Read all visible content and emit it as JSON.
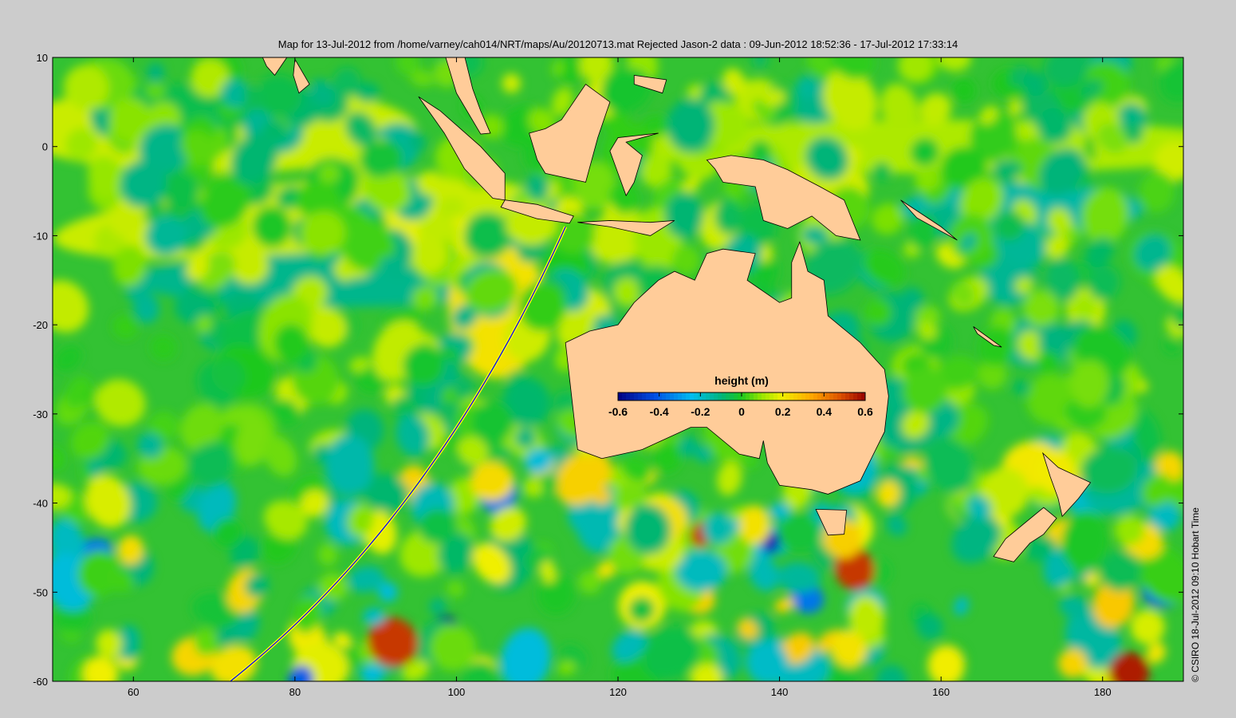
{
  "title": "Map for 13-Jul-2012 from /home/varney/cah014/NRT/maps/Au/20120713.mat  Rejected Jason-2 data : 09-Jun-2012 18:52:36 - 17-Jul-2012 17:33:14",
  "copyright": "© CSIRO 18-Jul-2012 09:10 Hobart Time",
  "chart_data": {
    "type": "heatmap",
    "title": "Map for 13-Jul-2012 from /home/varney/cah014/NRT/maps/Au/20120713.mat  Rejected Jason-2 data : 09-Jun-2012 18:52:36 - 17-Jul-2012 17:33:14",
    "xlim": [
      50,
      190
    ],
    "ylim": [
      -60,
      10
    ],
    "xticks": [
      "60",
      "80",
      "100",
      "120",
      "140",
      "160",
      "180"
    ],
    "yticks": [
      "10",
      "0",
      "-10",
      "-20",
      "-30",
      "-40",
      "-50",
      "-60"
    ],
    "colorbar": {
      "label": "height (m)",
      "range": [
        -0.6,
        0.6
      ],
      "ticks": [
        "-0.6",
        "-0.4",
        "-0.2",
        "0",
        "0.2",
        "0.4",
        "0.6"
      ],
      "colormap": "jet"
    },
    "land_color": "#ffcc99",
    "rejected_track": {
      "start": [
        113.5,
        -9
      ],
      "end": [
        72,
        -60
      ]
    }
  }
}
